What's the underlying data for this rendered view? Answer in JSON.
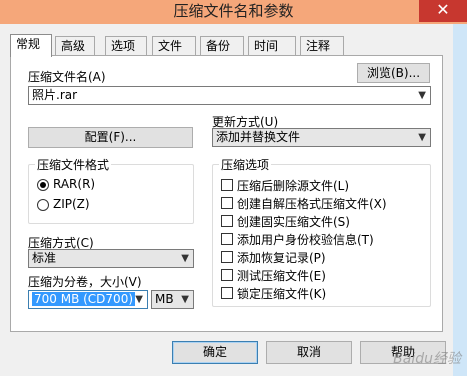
{
  "window": {
    "title": "压缩文件名和参数",
    "close_symbol": "✕"
  },
  "tabs": [
    {
      "label": "常规",
      "active": true
    },
    {
      "label": "高级"
    },
    {
      "label": "选项"
    },
    {
      "label": "文件"
    },
    {
      "label": "备份"
    },
    {
      "label": "时间"
    },
    {
      "label": "注释"
    }
  ],
  "archive_name": {
    "label": "压缩文件名(A)",
    "value": "照片.rar",
    "browse_label": "浏览(B)..."
  },
  "update_mode": {
    "label": "更新方式(U)",
    "value": "添加并替换文件"
  },
  "profile_button": "配置(F)...",
  "format_group": {
    "title": "压缩文件格式",
    "options": [
      {
        "label": "RAR(R)",
        "selected": true
      },
      {
        "label": "ZIP(Z)",
        "selected": false
      }
    ]
  },
  "method": {
    "label": "压缩方式(C)",
    "value": "标准"
  },
  "split": {
    "label": "压缩为分卷，大小(V)",
    "value": "700 MB  (CD700)",
    "unit": "MB"
  },
  "options_group": {
    "title": "压缩选项",
    "items": [
      {
        "label": "压缩后删除源文件(L)",
        "checked": false
      },
      {
        "label": "创建自解压格式压缩文件(X)",
        "checked": false
      },
      {
        "label": "创建固实压缩文件(S)",
        "checked": false
      },
      {
        "label": "添加用户身份校验信息(T)",
        "checked": false
      },
      {
        "label": "添加恢复记录(P)",
        "checked": false
      },
      {
        "label": "测试压缩文件(E)",
        "checked": false
      },
      {
        "label": "锁定压缩文件(K)",
        "checked": false
      }
    ]
  },
  "buttons": {
    "ok": "确定",
    "cancel": "取消",
    "help": "帮助"
  },
  "watermark": "Baidu经验"
}
